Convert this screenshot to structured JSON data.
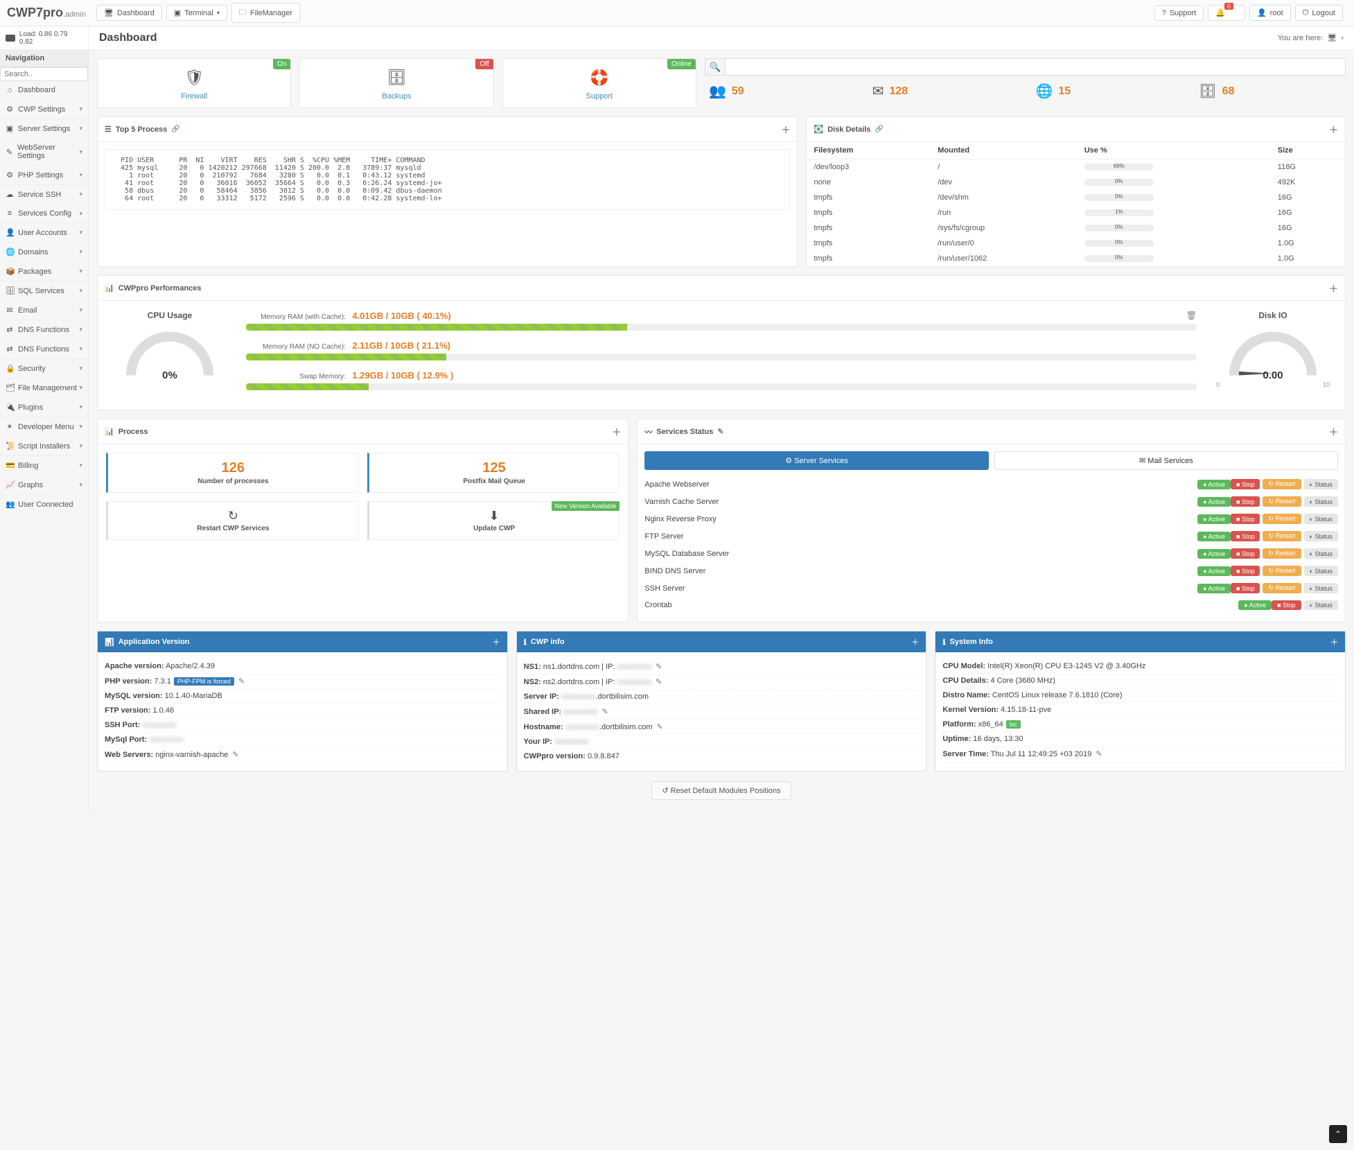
{
  "brand": {
    "main": "CWP7",
    "suffix": "pro",
    "sub": ".admin"
  },
  "topbar": {
    "dashboard": "Dashboard",
    "terminal": "Terminal",
    "filemanager": "FileManager",
    "support": "Support",
    "notif_count": "0",
    "user": "root",
    "logout": "Logout"
  },
  "load": {
    "label": "Load:",
    "values": "0.86  0.79  0.82"
  },
  "page_title": "Dashboard",
  "breadcrumb": {
    "label": "You are here:",
    "chev": "›"
  },
  "nav": {
    "header": "Navigation",
    "search_placeholder": "Search..",
    "items": [
      {
        "icon": "⌂",
        "label": "Dashboard",
        "expand": false
      },
      {
        "icon": "⚙",
        "label": "CWP Settings",
        "expand": true
      },
      {
        "icon": "▣",
        "label": "Server Settings",
        "expand": true
      },
      {
        "icon": "✎",
        "label": "WebServer Settings",
        "expand": true
      },
      {
        "icon": "⚙",
        "label": "PHP Settings",
        "expand": true
      },
      {
        "icon": "☁",
        "label": "Service SSH",
        "expand": true
      },
      {
        "icon": "≡",
        "label": "Services Config",
        "expand": true
      },
      {
        "icon": "👤",
        "label": "User Accounts",
        "expand": true
      },
      {
        "icon": "🌐",
        "label": "Domains",
        "expand": true
      },
      {
        "icon": "📦",
        "label": "Packages",
        "expand": true
      },
      {
        "icon": "🗄",
        "label": "SQL Services",
        "expand": true
      },
      {
        "icon": "✉",
        "label": "Email",
        "expand": true
      },
      {
        "icon": "⇄",
        "label": "DNS Functions",
        "expand": true
      },
      {
        "icon": "⇄",
        "label": "DNS Functions",
        "expand": true
      },
      {
        "icon": "🔒",
        "label": "Security",
        "expand": true
      },
      {
        "icon": "🗂",
        "label": "File Management",
        "expand": true
      },
      {
        "icon": "🔌",
        "label": "Plugins",
        "expand": true
      },
      {
        "icon": "✴",
        "label": "Developer Menu",
        "expand": true
      },
      {
        "icon": "📜",
        "label": "Script Installers",
        "expand": true
      },
      {
        "icon": "💳",
        "label": "Billing",
        "expand": true
      },
      {
        "icon": "📈",
        "label": "Graphs",
        "expand": true
      },
      {
        "icon": "👥",
        "label": "User Connected",
        "expand": false
      }
    ]
  },
  "tiles": [
    {
      "icon": "🛡",
      "label": "Firewall",
      "badge": "On",
      "badge_cls": "bg-green"
    },
    {
      "icon": "🗄",
      "label": "Backups",
      "badge": "Off",
      "badge_cls": "bg-red"
    },
    {
      "icon": "🛟",
      "label": "Support",
      "badge": "Online",
      "badge_cls": "bg-green"
    }
  ],
  "stats": [
    {
      "icon": "👥",
      "val": "59"
    },
    {
      "icon": "✉",
      "val": "128"
    },
    {
      "icon": "🌐",
      "val": "15"
    },
    {
      "icon": "🗄",
      "val": "68"
    }
  ],
  "top5": {
    "title": "Top 5 Process",
    "text": "  PID USER      PR  NI    VIRT    RES    SHR S  %CPU %MEM     TIME+ COMMAND\n  425 mysql     20   0 1420212 297668  11420 S 200.0  2.8   3789:37 mysqld\n    1 root      20   0  210792   7684   3280 S   0.0  0.1   0:43.12 systemd\n   41 root      20   0   36016  36052  35664 S   0.0  0.3   6:26.24 systemd-jo+\n   58 dbus      20   0   58464   3856   3012 S   0.0  0.0   0:09.42 dbus-daemon\n   64 root      20   0   33312   5172   2596 S   0.0  0.0   0:42.28 systemd-lo+"
  },
  "disk": {
    "title": "Disk Details",
    "headers": {
      "fs": "Filesystem",
      "mount": "Mounted",
      "use": "Use %",
      "size": "Size"
    },
    "rows": [
      {
        "fs": "/dev/loop3",
        "mount": "/",
        "use": "69%",
        "pct": 69,
        "size": "118G"
      },
      {
        "fs": "none",
        "mount": "/dev",
        "use": "0%",
        "pct": 0,
        "size": "492K"
      },
      {
        "fs": "tmpfs",
        "mount": "/dev/shm",
        "use": "0%",
        "pct": 0,
        "size": "16G"
      },
      {
        "fs": "tmpfs",
        "mount": "/run",
        "use": "1%",
        "pct": 1,
        "size": "16G"
      },
      {
        "fs": "tmpfs",
        "mount": "/sys/fs/cgroup",
        "use": "0%",
        "pct": 0,
        "size": "16G"
      },
      {
        "fs": "tmpfs",
        "mount": "/run/user/0",
        "use": "0%",
        "pct": 0,
        "size": "1.0G"
      },
      {
        "fs": "tmpfs",
        "mount": "/run/user/1062",
        "use": "0%",
        "pct": 0,
        "size": "1.0G"
      }
    ]
  },
  "perf": {
    "title": "CWPpro Performances",
    "cpu": {
      "title": "CPU Usage",
      "val": "0%"
    },
    "ram1": {
      "lbl": "Memory RAM (with Cache):",
      "val": "4.01GB / 10GB ( 40.1%)",
      "pct": 40.1
    },
    "ram2": {
      "lbl": "Memory RAM (NO Cache):",
      "val": "2.11GB / 10GB ( 21.1%)",
      "pct": 21.1
    },
    "swap": {
      "lbl": "Swap Memory:",
      "val": "1.29GB / 10GB ( 12.9% )",
      "pct": 12.9
    },
    "disk": {
      "title": "Disk IO",
      "val": "0.00",
      "min": "0",
      "max": "10"
    }
  },
  "process": {
    "title": "Process",
    "num_proc": {
      "val": "126",
      "lbl": "Number of processes"
    },
    "mailq": {
      "val": "125",
      "lbl": "Postfix Mail Queue"
    },
    "restart": "Restart CWP Services",
    "update": "Update CWP",
    "new_ver": "New Version Available"
  },
  "services": {
    "title": "Services Status",
    "tab1": "Server Services",
    "tab2": "Mail Services",
    "labels": {
      "active": "Active",
      "stop": "Stop",
      "restart": "Restart",
      "status": "Status"
    },
    "rows": [
      {
        "name": "Apache Webserver",
        "all": true
      },
      {
        "name": "Varnish Cache Server",
        "all": true
      },
      {
        "name": "Nginx Reverse Proxy",
        "all": true
      },
      {
        "name": "FTP Server",
        "all": true
      },
      {
        "name": "MySQL Database Server",
        "all": true
      },
      {
        "name": "BIND DNS Server",
        "all": true
      },
      {
        "name": "SSH Server",
        "all": true
      },
      {
        "name": "Crontab",
        "all": false
      }
    ]
  },
  "app_ver": {
    "title": "Application Version",
    "rows": [
      {
        "k": "Apache version:",
        "v": "Apache/2.4.39"
      },
      {
        "k": "PHP version:",
        "v": "7.3.1",
        "tag": "PHP-FPM is forced",
        "edit": true
      },
      {
        "k": "MySQL version:",
        "v": "10.1.40-MariaDB"
      },
      {
        "k": "FTP version:",
        "v": "1.0.46"
      },
      {
        "k": "SSH Port:",
        "v": "",
        "blur": true
      },
      {
        "k": "MySql Port:",
        "v": "",
        "blur": true
      },
      {
        "k": "Web Servers:",
        "v": "nginx-varnish-apache",
        "edit": true
      }
    ]
  },
  "cwp_info": {
    "title": "CWP info",
    "rows": [
      {
        "k": "NS1:",
        "v": "ns1.dortdns.com | IP:",
        "blur": true,
        "edit": true
      },
      {
        "k": "NS2:",
        "v": "ns2.dortdns.com | IP:",
        "blur": true,
        "edit": true
      },
      {
        "k": "Server IP:",
        "v": "",
        "blur": true,
        "suffix": ".dortbilisim.com"
      },
      {
        "k": "Shared IP:",
        "v": "",
        "blur": true,
        "edit": true
      },
      {
        "k": "Hostname:",
        "v": "",
        "blur": true,
        "suffix": ".dortbilisim.com",
        "edit": true
      },
      {
        "k": "Your IP:",
        "v": "",
        "blur": true
      },
      {
        "k": "CWPpro version:",
        "v": "0.9.8.847"
      }
    ]
  },
  "sys_info": {
    "title": "System Info",
    "rows": [
      {
        "k": "CPU Model:",
        "v": "Intel(R) Xeon(R) CPU E3-1245 V2 @ 3.40GHz"
      },
      {
        "k": "CPU Details:",
        "v": "4 Core (3680 MHz)"
      },
      {
        "k": "Distro Name:",
        "v": "CentOS Linux release 7.6.1810 (Core)"
      },
      {
        "k": "Kernel Version:",
        "v": "4.15.18-11-pve"
      },
      {
        "k": "Platform:",
        "v": "x86_64",
        "tag": "lxc",
        "tag_cls": "green"
      },
      {
        "k": "Uptime:",
        "v": "16 days, 13:30"
      },
      {
        "k": "Server Time:",
        "v": "Thu Jul 11 12:49:25 +03 2019",
        "edit": true
      }
    ]
  },
  "reset_btn": "Reset Default Modules Positions"
}
